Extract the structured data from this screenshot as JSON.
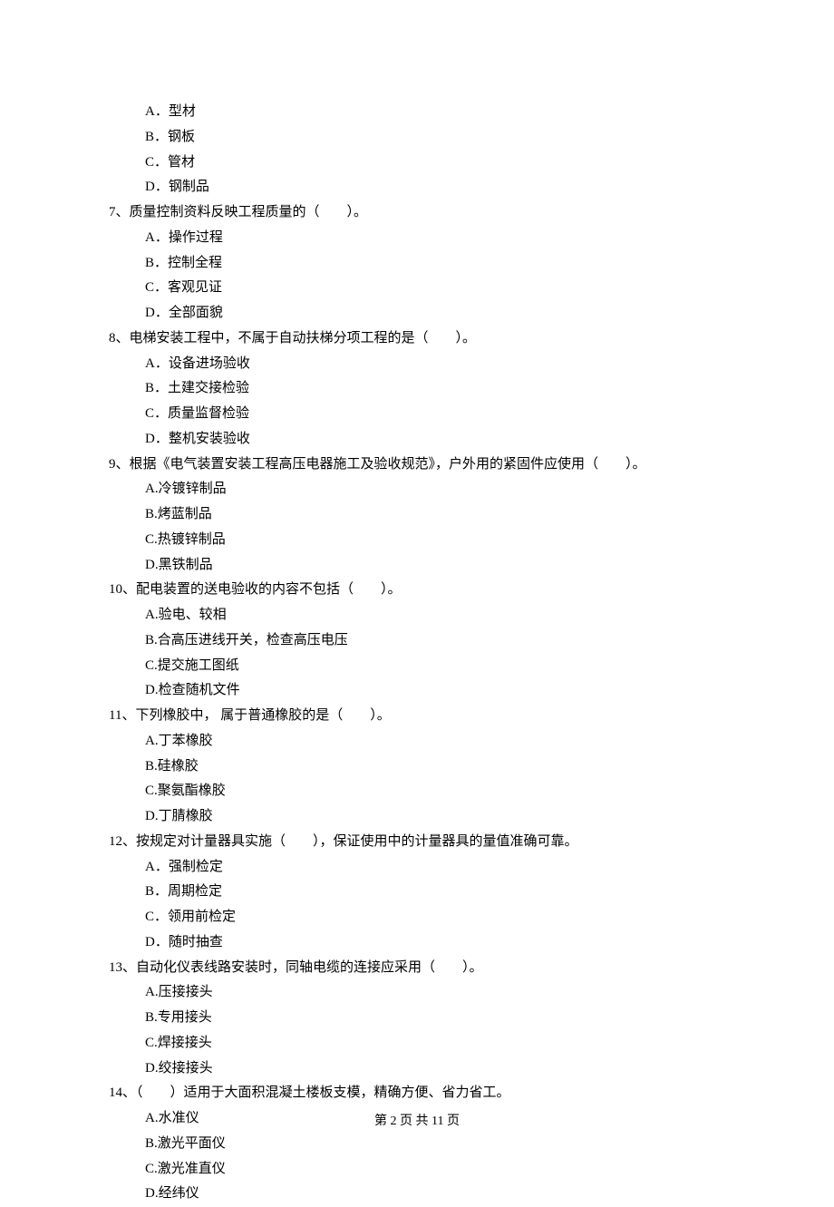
{
  "q6_continued": {
    "options": [
      {
        "letter": "A．",
        "text": "型材"
      },
      {
        "letter": "B．",
        "text": "钢板"
      },
      {
        "letter": "C．",
        "text": "管材"
      },
      {
        "letter": "D．",
        "text": "钢制品"
      }
    ]
  },
  "questions": [
    {
      "num": "7、",
      "stem_pre": "质量控制资料反映工程质量的（",
      "stem_post": "）。",
      "options": [
        {
          "letter": "A．",
          "text": "操作过程"
        },
        {
          "letter": "B．",
          "text": "控制全程"
        },
        {
          "letter": "C．",
          "text": "客观见证"
        },
        {
          "letter": "D．",
          "text": "全部面貌"
        }
      ]
    },
    {
      "num": "8、",
      "stem_pre": "电梯安装工程中，不属于自动扶梯分项工程的是（",
      "stem_post": "）。",
      "options": [
        {
          "letter": "A．",
          "text": "设备进场验收"
        },
        {
          "letter": "B．",
          "text": "土建交接检验"
        },
        {
          "letter": "C．",
          "text": "质量监督检验"
        },
        {
          "letter": "D．",
          "text": "整机安装验收"
        }
      ]
    },
    {
      "num": "9、",
      "stem_pre": "根据《电气装置安装工程高压电器施工及验收规范》，户外用的紧固件应使用（",
      "stem_post": "）。",
      "options": [
        {
          "letter": "A.",
          "text": "冷镀锌制品"
        },
        {
          "letter": "B.",
          "text": "烤蓝制品"
        },
        {
          "letter": "C.",
          "text": "热镀锌制品"
        },
        {
          "letter": "D.",
          "text": "黑铁制品"
        }
      ]
    },
    {
      "num": "10、",
      "stem_pre": "配电装置的送电验收的内容不包括（",
      "stem_post": "）。",
      "options": [
        {
          "letter": "A.",
          "text": "验电、较相"
        },
        {
          "letter": "B.",
          "text": "合高压进线开关，检查高压电压"
        },
        {
          "letter": "C.",
          "text": "提交施工图纸"
        },
        {
          "letter": "D.",
          "text": "检查随机文件"
        }
      ]
    },
    {
      "num": "11、",
      "stem_pre": "下列橡胶中，  属于普通橡胶的是（",
      "stem_post": "）。",
      "options": [
        {
          "letter": "A.",
          "text": "丁苯橡胶"
        },
        {
          "letter": "B.",
          "text": "硅橡胶"
        },
        {
          "letter": "C.",
          "text": "聚氨酯橡胶"
        },
        {
          "letter": "D.",
          "text": "丁腈橡胶"
        }
      ]
    },
    {
      "num": "12、",
      "stem_pre": "按规定对计量器具实施（",
      "stem_post": "），保证使用中的计量器具的量值准确可靠。",
      "options": [
        {
          "letter": "A．",
          "text": "强制检定"
        },
        {
          "letter": "B．",
          "text": "周期检定"
        },
        {
          "letter": "C．",
          "text": "领用前检定"
        },
        {
          "letter": "D．",
          "text": "随时抽查"
        }
      ]
    },
    {
      "num": "13、",
      "stem_pre": "自动化仪表线路安装时，同轴电缆的连接应采用（",
      "stem_post": "）。",
      "options": [
        {
          "letter": "A.",
          "text": "压接接头"
        },
        {
          "letter": "B.",
          "text": "专用接头"
        },
        {
          "letter": "C.",
          "text": "焊接接头"
        },
        {
          "letter": "D.",
          "text": "绞接接头"
        }
      ]
    },
    {
      "num": "14、",
      "stem_pre": "（",
      "stem_post": "）适用于大面积混凝土楼板支模，精确方便、省力省工。",
      "options": [
        {
          "letter": "A.",
          "text": "水准仪"
        },
        {
          "letter": "B.",
          "text": "激光平面仪"
        },
        {
          "letter": "C.",
          "text": "激光准直仪"
        },
        {
          "letter": "D.",
          "text": "经纬仪"
        }
      ]
    }
  ],
  "blank": "　　",
  "footer": "第 2 页 共 11 页"
}
